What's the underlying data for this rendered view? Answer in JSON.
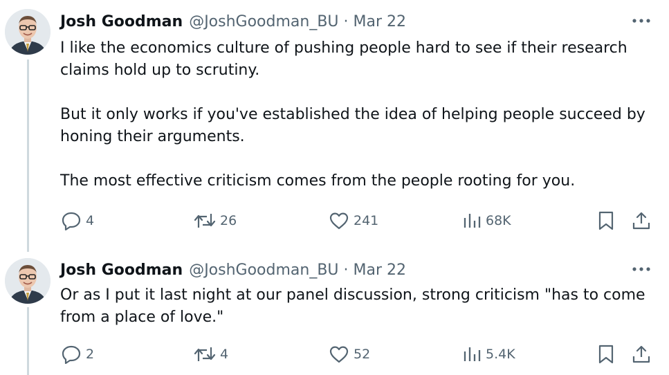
{
  "tweets": [
    {
      "author": {
        "name": "Josh Goodman",
        "handle": "@JoshGoodman_BU"
      },
      "separator": "·",
      "date": "Mar 22",
      "paragraphs": [
        "I like the economics culture of pushing people hard to see if their research claims hold up to scrutiny.",
        "But it only works if you've established the idea of helping people succeed by honing their arguments.",
        "The most effective criticism comes from the people rooting for you."
      ],
      "metrics": {
        "replies": "4",
        "reposts": "26",
        "likes": "241",
        "views": "68K"
      }
    },
    {
      "author": {
        "name": "Josh Goodman",
        "handle": "@JoshGoodman_BU"
      },
      "separator": "·",
      "date": "Mar 22",
      "paragraphs": [
        "Or as I put it last night at our panel discussion, strong criticism \"has to come from a place of love.\""
      ],
      "metrics": {
        "replies": "2",
        "reposts": "4",
        "likes": "52",
        "views": "5.4K"
      }
    }
  ],
  "icons": {
    "more": "more-horizontal-icon",
    "reply": "reply-icon",
    "repost": "repost-icon",
    "like": "heart-icon",
    "views": "analytics-icon",
    "bookmark": "bookmark-icon",
    "share": "share-icon"
  },
  "colors": {
    "text": "#0f1419",
    "secondary": "#536471",
    "thread_line": "#cfd9de"
  }
}
